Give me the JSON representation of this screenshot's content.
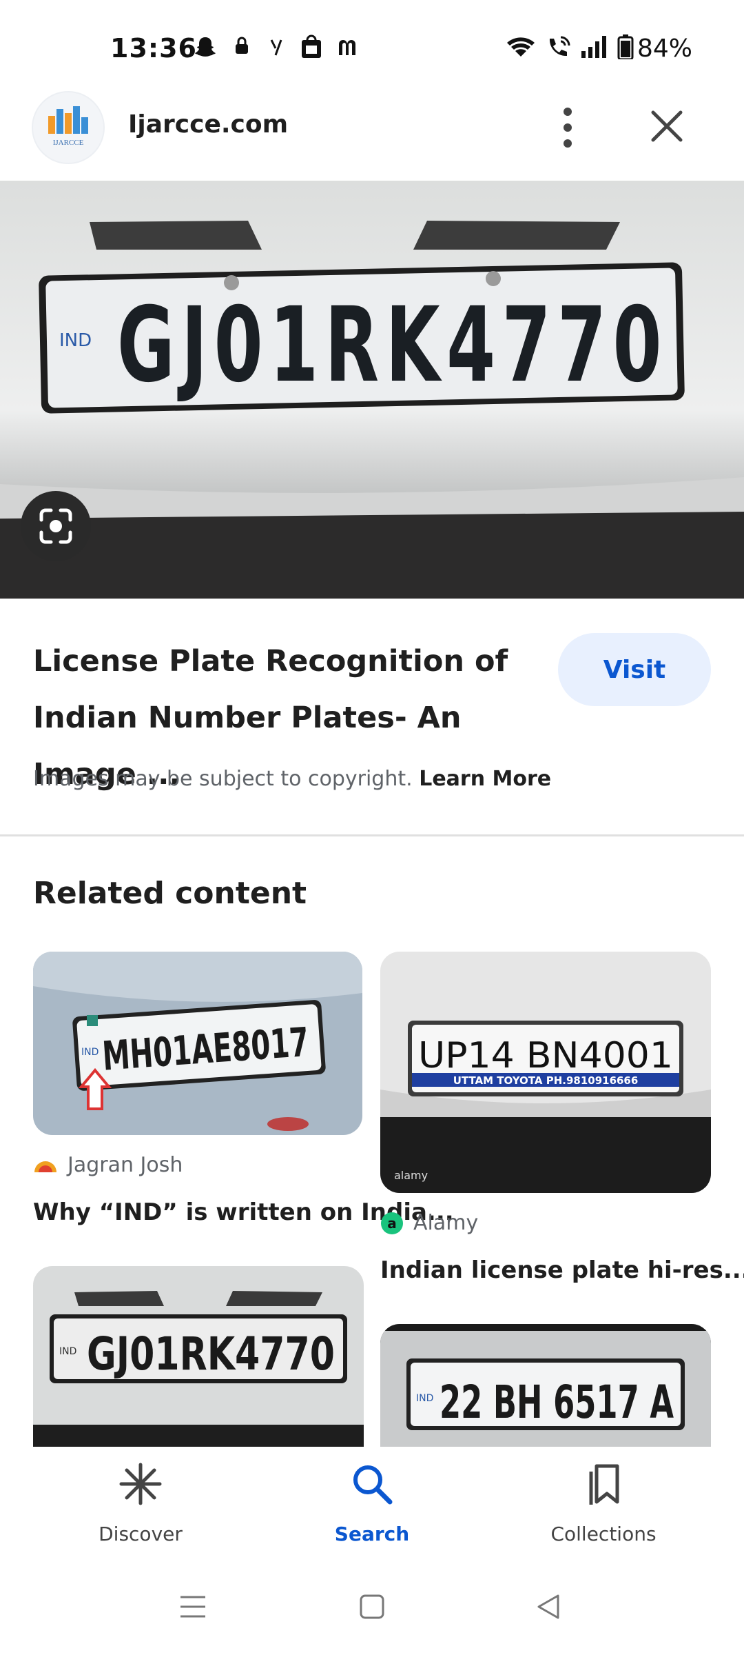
{
  "status_bar": {
    "time": "13:36",
    "battery": "84%"
  },
  "header": {
    "site_name": "Ijarcce.com",
    "logo_text": "IJARCCE"
  },
  "hero": {
    "plate_text": "GJ01RK4770",
    "plate_country": "IND"
  },
  "result": {
    "title": "License Plate Recognition of Indian Number Plates- An Image ...",
    "visit_label": "Visit",
    "copyright_text": "Images may be subject to copyright.",
    "learn_more": "Learn More"
  },
  "related": {
    "heading": "Related content",
    "cards": [
      {
        "plate": "MH01AE8017",
        "plate_country": "IND",
        "source": "Jagran Josh",
        "caption": "Why “IND” is written on India..."
      },
      {
        "plate": "UP14 BN4001",
        "plate_sub": "UTTAM TOYOTA PH.9810916666",
        "source": "Alamy",
        "caption": "Indian license plate hi-res..."
      },
      {
        "plate": "GJ01RK4770",
        "plate_country": "IND"
      },
      {
        "plate": "22 BH 6517 A",
        "plate_country": "IND"
      }
    ]
  },
  "bottom_nav": {
    "items": [
      {
        "label": "Discover",
        "icon": "asterisk-icon",
        "active": false
      },
      {
        "label": "Search",
        "icon": "search-icon",
        "active": true
      },
      {
        "label": "Collections",
        "icon": "bookmarks-icon",
        "active": false
      }
    ]
  },
  "colors": {
    "accent": "#0b57d0",
    "visit_bg": "#e8f0fe"
  }
}
